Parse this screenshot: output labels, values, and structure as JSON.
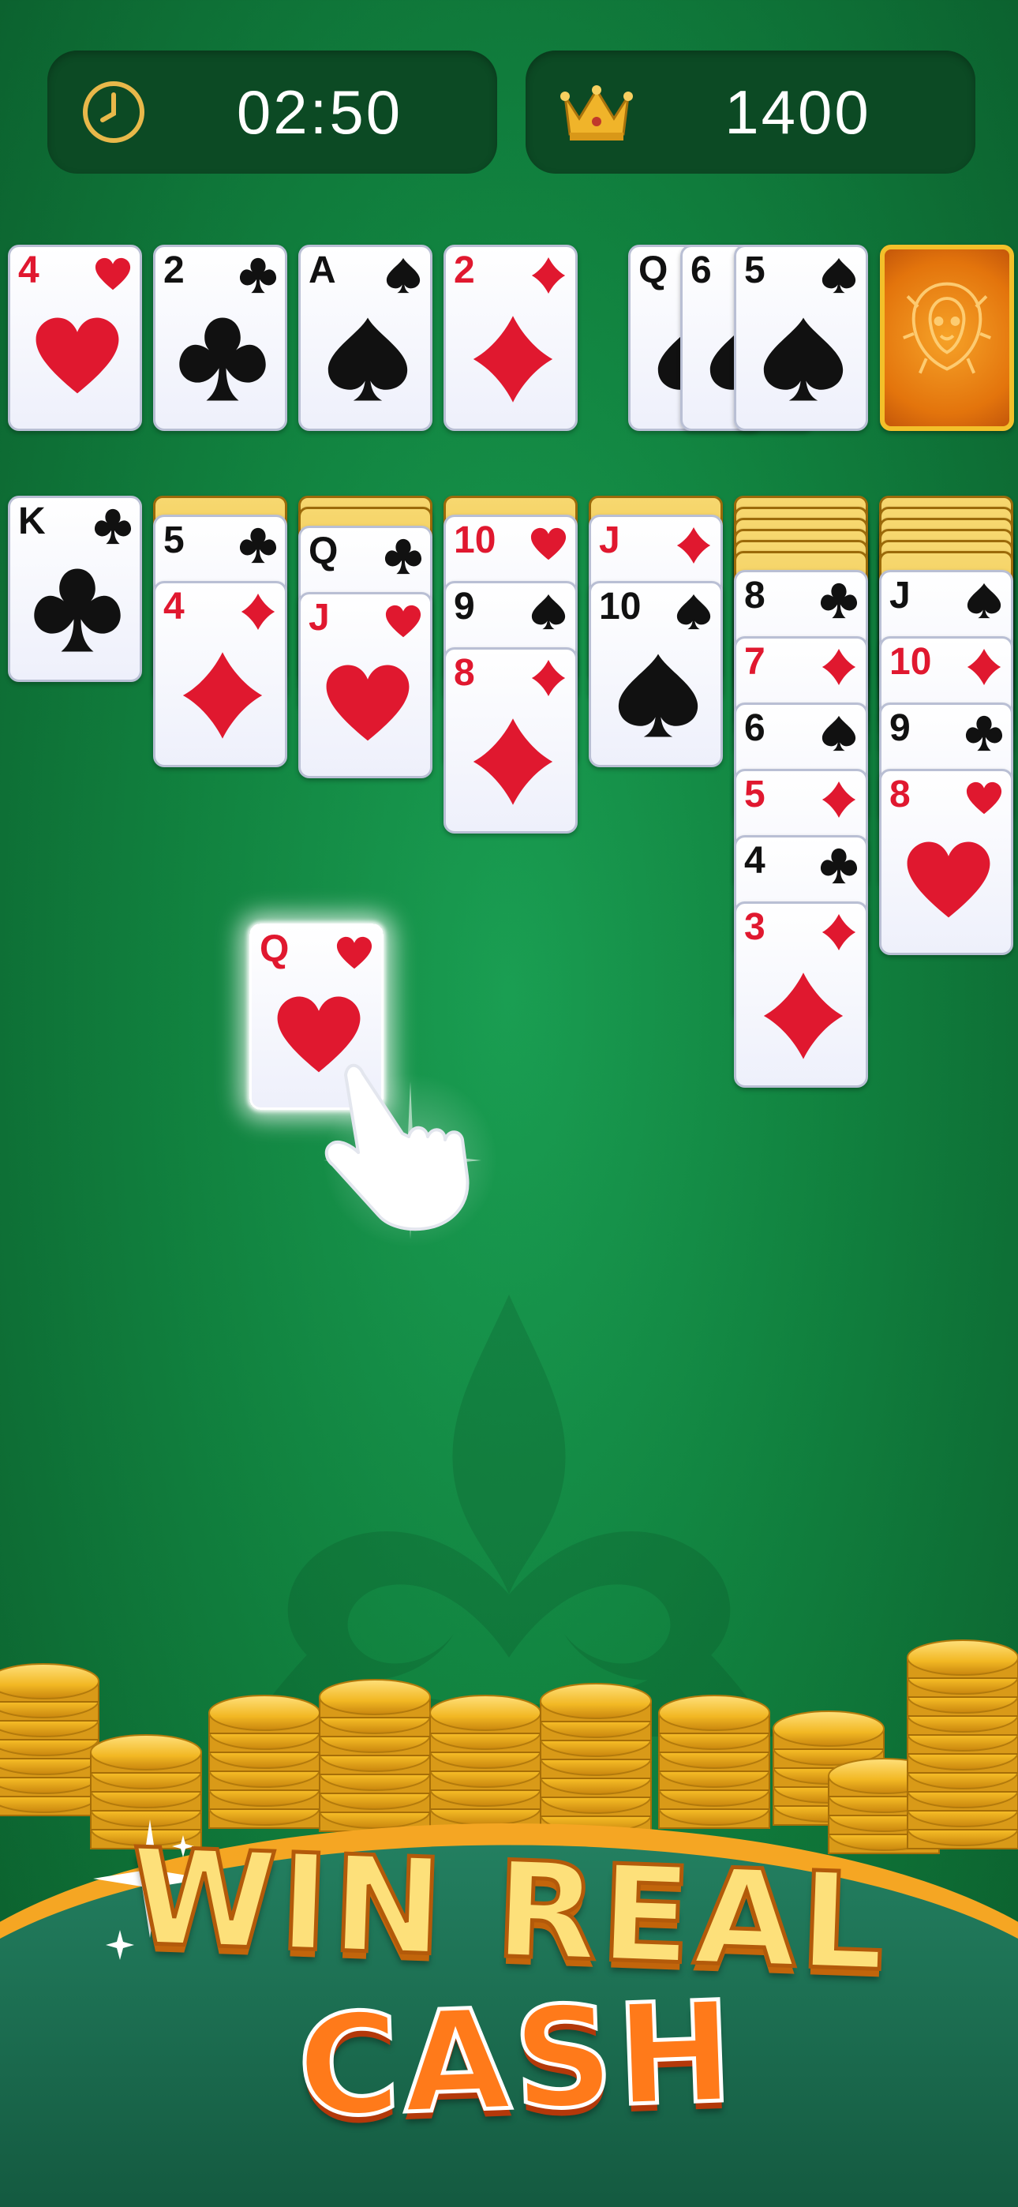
{
  "hud": {
    "timer": "02:50",
    "score": "1400",
    "timer_icon": "clock-icon",
    "score_icon": "crown-icon"
  },
  "foundations": [
    {
      "rank": "4",
      "suit": "hearts"
    },
    {
      "rank": "2",
      "suit": "clubs"
    },
    {
      "rank": "A",
      "suit": "spades"
    },
    {
      "rank": "2",
      "suit": "diamonds"
    }
  ],
  "waste": [
    {
      "rank": "Q",
      "suit": "spades"
    },
    {
      "rank": "6",
      "suit": "spades"
    },
    {
      "rank": "5",
      "suit": "spades"
    }
  ],
  "stock": {
    "icon": "lion-icon"
  },
  "tableau": [
    {
      "facedown": 0,
      "cards": [
        {
          "rank": "K",
          "suit": "clubs"
        }
      ]
    },
    {
      "facedown": 1,
      "cards": [
        {
          "rank": "5",
          "suit": "clubs"
        },
        {
          "rank": "4",
          "suit": "diamonds"
        }
      ]
    },
    {
      "facedown": 2,
      "cards": [
        {
          "rank": "Q",
          "suit": "clubs"
        },
        {
          "rank": "J",
          "suit": "hearts"
        }
      ]
    },
    {
      "facedown": 1,
      "cards": [
        {
          "rank": "10",
          "suit": "hearts"
        },
        {
          "rank": "9",
          "suit": "spades"
        },
        {
          "rank": "8",
          "suit": "diamonds"
        }
      ]
    },
    {
      "facedown": 1,
      "cards": [
        {
          "rank": "J",
          "suit": "diamonds"
        },
        {
          "rank": "10",
          "suit": "spades"
        }
      ]
    },
    {
      "facedown": 6,
      "cards": [
        {
          "rank": "8",
          "suit": "clubs"
        },
        {
          "rank": "7",
          "suit": "diamonds"
        },
        {
          "rank": "6",
          "suit": "spades"
        },
        {
          "rank": "5",
          "suit": "diamonds"
        },
        {
          "rank": "4",
          "suit": "clubs"
        },
        {
          "rank": "3",
          "suit": "diamonds"
        }
      ]
    },
    {
      "facedown": 6,
      "cards": [
        {
          "rank": "J",
          "suit": "spades"
        },
        {
          "rank": "10",
          "suit": "diamonds"
        },
        {
          "rank": "9",
          "suit": "clubs"
        },
        {
          "rank": "8",
          "suit": "hearts"
        }
      ]
    }
  ],
  "dragged_card": {
    "rank": "Q",
    "suit": "hearts"
  },
  "promo": {
    "line1": "WIN REAL",
    "line2": "CASH",
    "accent": "#f7a21b",
    "banner_color": "#1d7a5a",
    "coin_color": "#f2c232"
  },
  "colors": {
    "red_suit": "#e0182f",
    "black_suit": "#111111",
    "felt": "#138a43"
  }
}
